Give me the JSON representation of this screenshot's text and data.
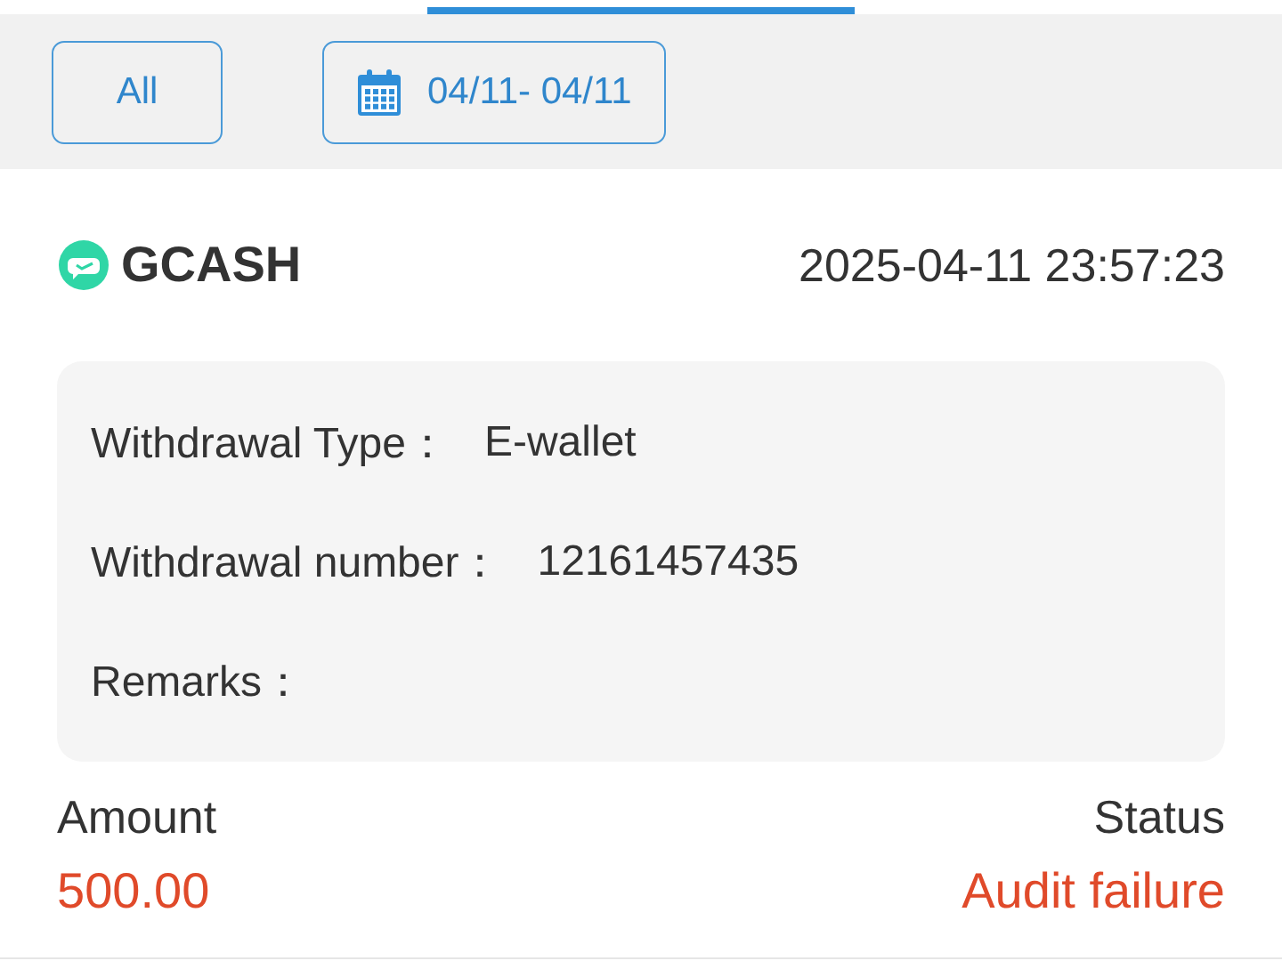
{
  "filters": [
    {
      "kind": "text",
      "label": "All"
    },
    {
      "kind": "date",
      "label": "04/11- 04/11"
    }
  ],
  "record": {
    "provider": "GCASH",
    "datetime": "2025-04-11 23:57:23",
    "details": [
      {
        "label": "Withdrawal Type：",
        "value": "E-wallet"
      },
      {
        "label": "Withdrawal number：",
        "value": "12161457435"
      },
      {
        "label": "Remarks："
      }
    ],
    "amount_label": "Amount",
    "amount": "500.00",
    "status_label": "Status",
    "status": "Audit failure"
  }
}
